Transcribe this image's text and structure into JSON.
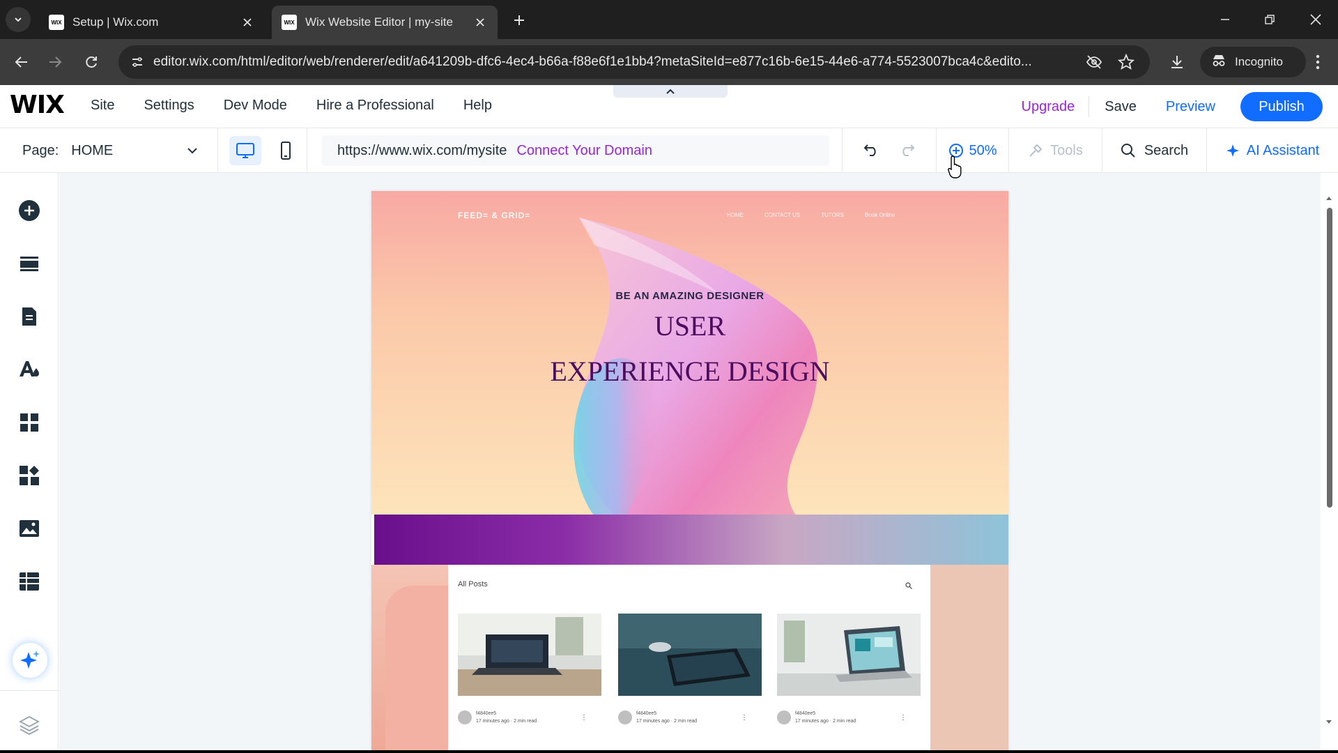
{
  "browser": {
    "tabs": [
      {
        "title": "Setup | Wix.com",
        "favicon": "WIX",
        "active": false
      },
      {
        "title": "Wix Website Editor | my-site",
        "favicon": "WIX",
        "active": true
      }
    ],
    "url": "editor.wix.com/html/editor/web/renderer/edit/a641209b-dfc6-4ec4-b66a-f88e6f1e1bb4?metaSiteId=e877c16b-6e15-44e6-a774-5523007bca4c&edito...",
    "incognito_label": "Incognito"
  },
  "wix": {
    "logo": "WIX",
    "menu": [
      "Site",
      "Settings",
      "Dev Mode",
      "Hire a Professional",
      "Help"
    ],
    "upgrade": "Upgrade",
    "save": "Save",
    "preview": "Preview",
    "publish": "Publish",
    "page_label": "Page:",
    "page_name": "HOME",
    "site_url": "https://www.wix.com/mysite",
    "connect_domain": "Connect Your Domain",
    "zoom": "50%",
    "tools": "Tools",
    "search": "Search",
    "ai_assistant": "AI Assistant",
    "accent_color": "#116dff",
    "upgrade_color": "#9a27d5"
  },
  "left_rail": [
    "add-elements-icon",
    "sections-icon",
    "pages-icon",
    "theme-design-icon",
    "apps-icon",
    "business-apps-icon",
    "media-icon",
    "cms-table-icon",
    "ai-sparkle-icon",
    "layers-icon"
  ],
  "site": {
    "logo": "FEED= & GRID=",
    "nav": [
      "HOME",
      "CONTACT US",
      "TUTORS",
      "Book Online"
    ],
    "kicker": "BE AN AMAZING DESIGNER",
    "title_line1": "USER",
    "title_line2": "EXPERIENCE DESIGN",
    "blog_heading": "All Posts",
    "posts": [
      {
        "author": "f4840ee5",
        "meta": "17 minutes ago · 2 min read"
      },
      {
        "author": "f4840ee5",
        "meta": "17 minutes ago · 2 min read"
      },
      {
        "author": "f4840ee5",
        "meta": "17 minutes ago · 2 min read"
      }
    ]
  }
}
